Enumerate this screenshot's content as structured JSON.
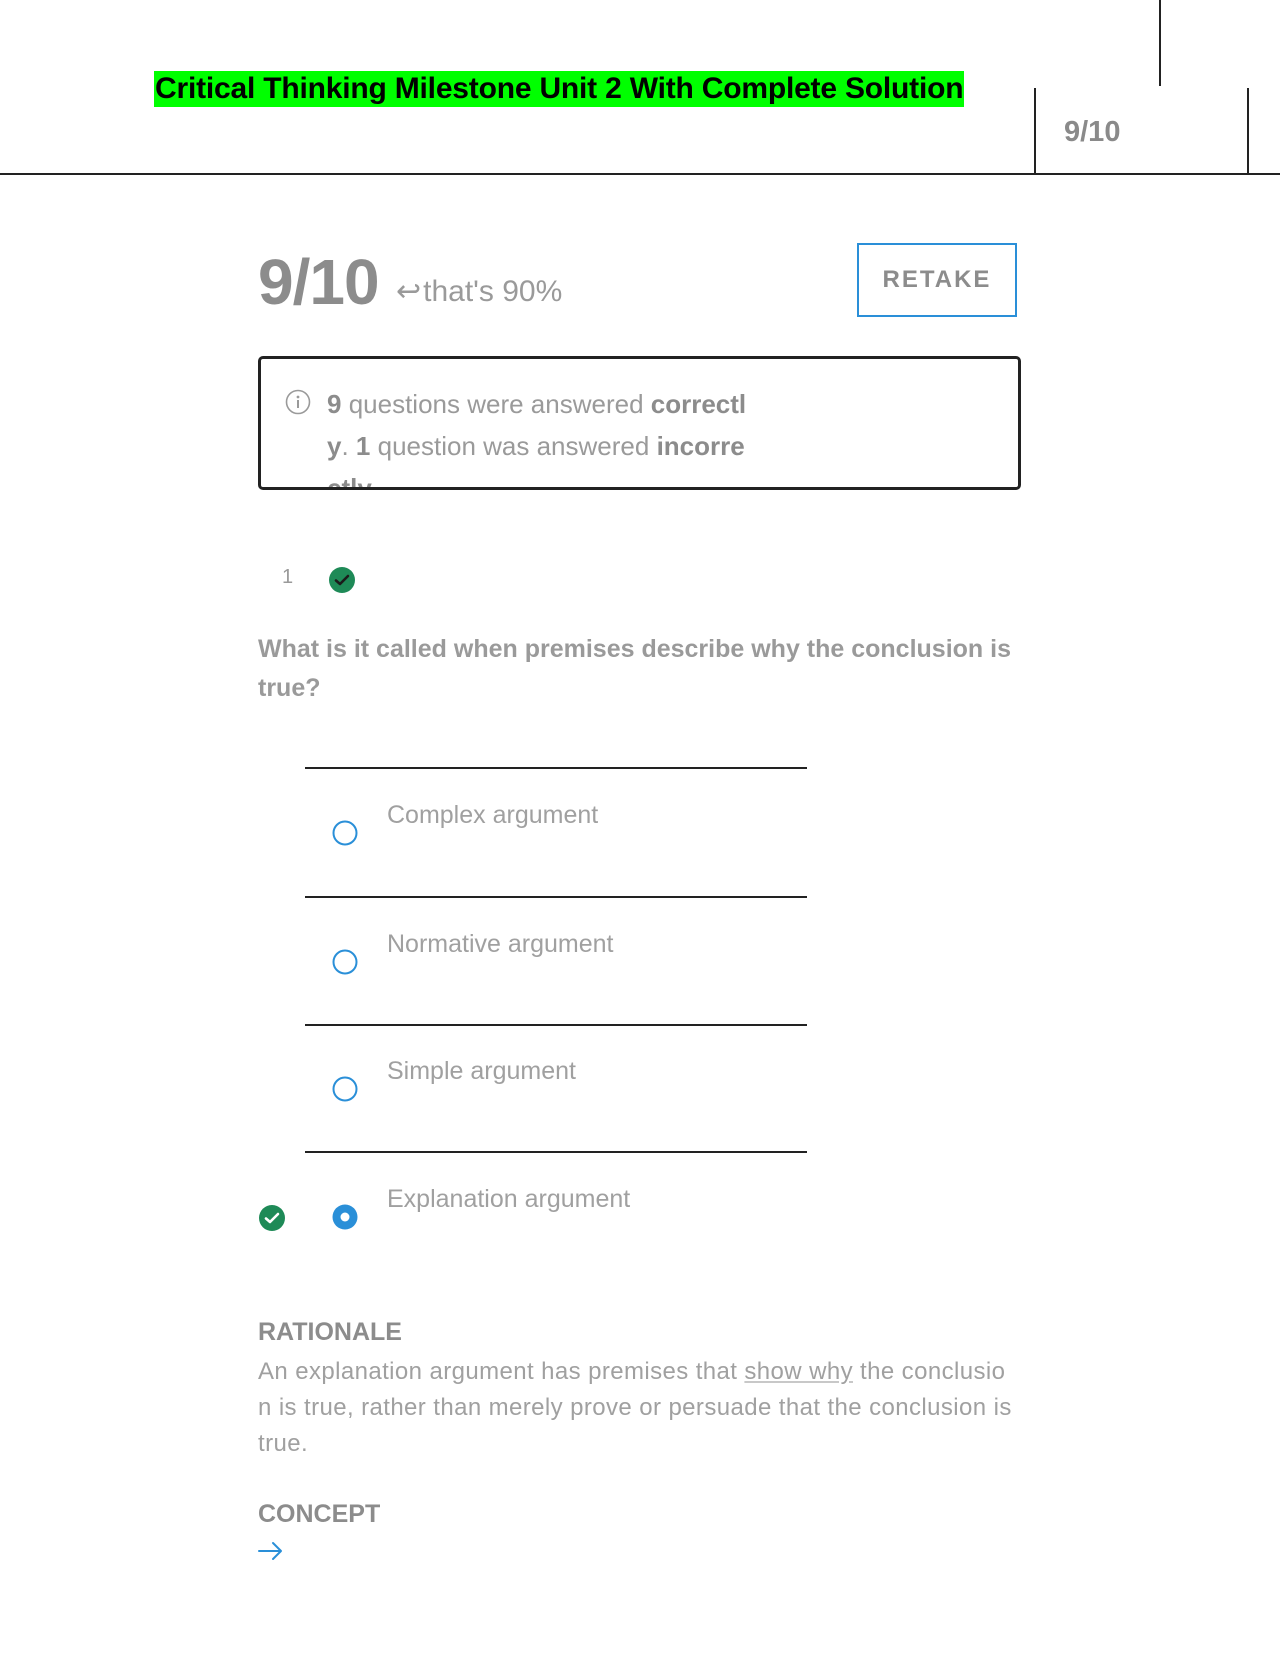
{
  "header": {
    "doc_title": "Critical Thinking Milestone Unit 2 With Complete Solution",
    "score": "9/10"
  },
  "score_section": {
    "score": "9/10",
    "percent_text": "that's 90%",
    "retake_label": "RETAKE"
  },
  "summary": {
    "correct_count": "9",
    "correct_mid": " questions were answered ",
    "correct_word": "correctly",
    "incorrect_count": "1",
    "incorrect_mid": " question was answered ",
    "incorrect_word": "incorrectly"
  },
  "question": {
    "number": "1",
    "text": "What is it called when premises describe why the conclusion is true?",
    "options": [
      {
        "label": "Complex argument",
        "selected": false
      },
      {
        "label": "Normative argument",
        "selected": false
      },
      {
        "label": "Simple argument",
        "selected": false
      },
      {
        "label": "Explanation argument",
        "selected": true,
        "correct": true
      }
    ]
  },
  "rationale": {
    "heading": "RATIONALE",
    "text_before": "An explanation argument has premises that ",
    "text_underlined": "show why",
    "text_after": " the conclusion is true, rather than merely prove or persuade that the conclusion is true."
  },
  "concept": {
    "heading": "CONCEPT"
  },
  "colors": {
    "accent_blue": "#2a8fd8",
    "correct_green": "#1e8a57",
    "highlight": "#00ff00"
  }
}
